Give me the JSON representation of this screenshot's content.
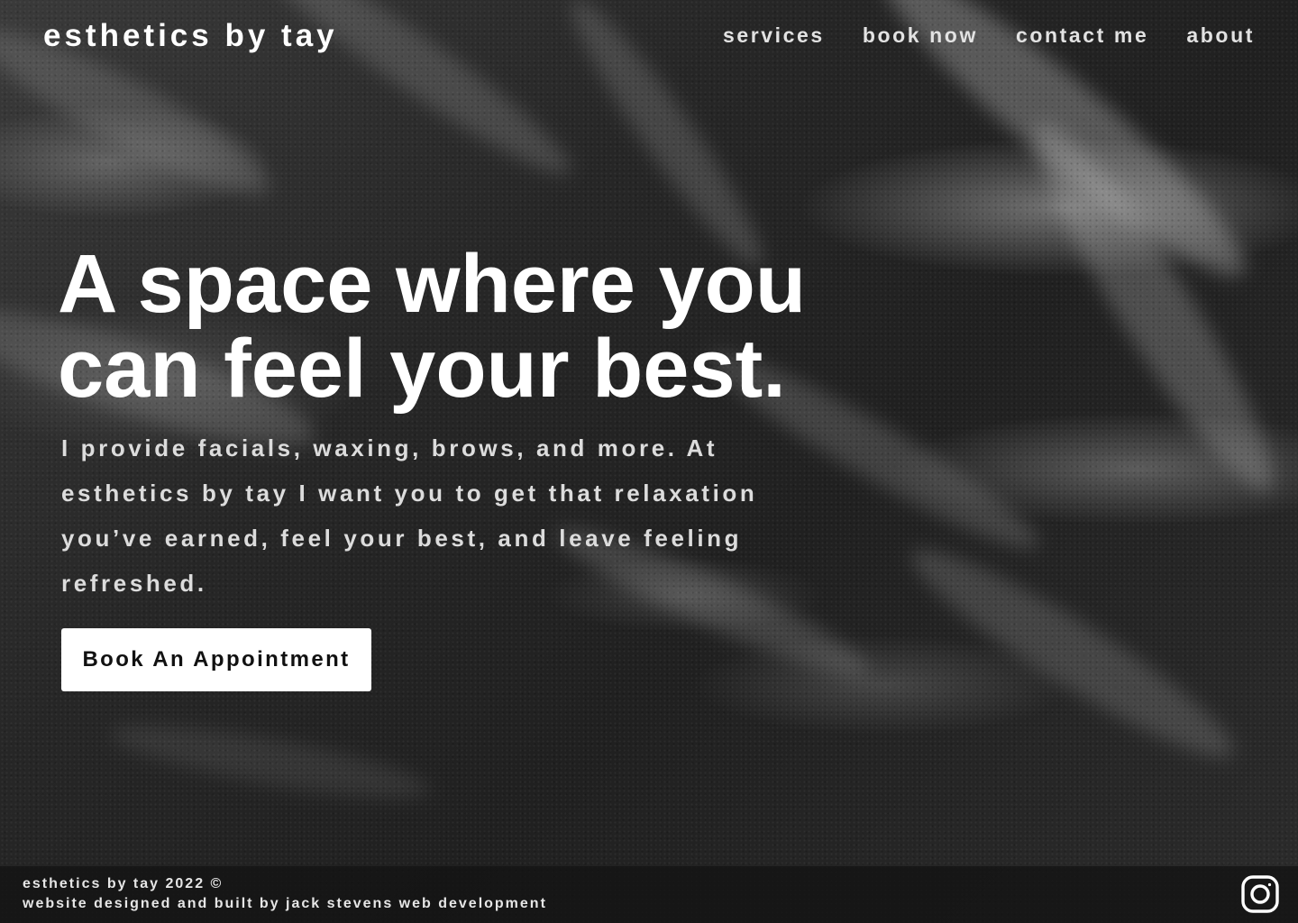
{
  "header": {
    "brand": "esthetics by tay",
    "nav": [
      {
        "label": "services"
      },
      {
        "label": "book now"
      },
      {
        "label": "contact me"
      },
      {
        "label": "about"
      }
    ]
  },
  "hero": {
    "headline": "A space where you can feel your best.",
    "description": "I provide facials, waxing, brows, and more. At esthetics by tay I want you to get that relaxation you’ve earned, feel your best, and leave feeling refreshed.",
    "cta_label": "Book An Appointment"
  },
  "footer": {
    "copyright": "esthetics by tay 2022 ©",
    "credit": "website designed and built by jack stevens web development",
    "social_icon": "instagram-icon"
  }
}
